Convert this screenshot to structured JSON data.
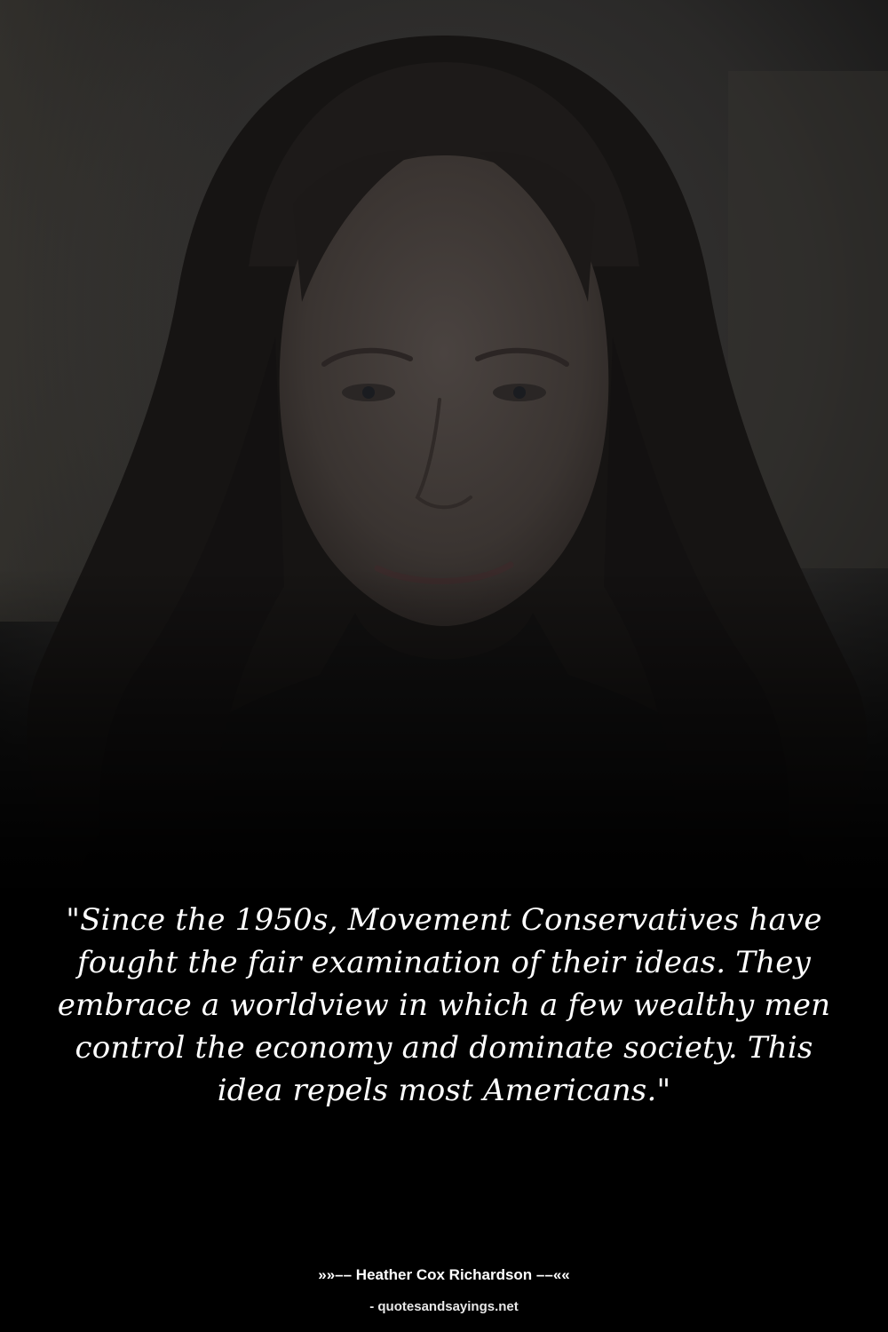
{
  "quote": {
    "text": "\"Since the 1950s, Movement Conservatives have fought the fair examination of their ideas. They embrace a worldview in which a few wealthy men control the economy and dominate society. This idea repels most Americans.\""
  },
  "attribution": {
    "author_line": "»»–– Heather Cox Richardson ––««"
  },
  "footer": {
    "site": "- quotesandsayings.net"
  },
  "colors": {
    "background": "#060606",
    "text": "#ffffff"
  }
}
